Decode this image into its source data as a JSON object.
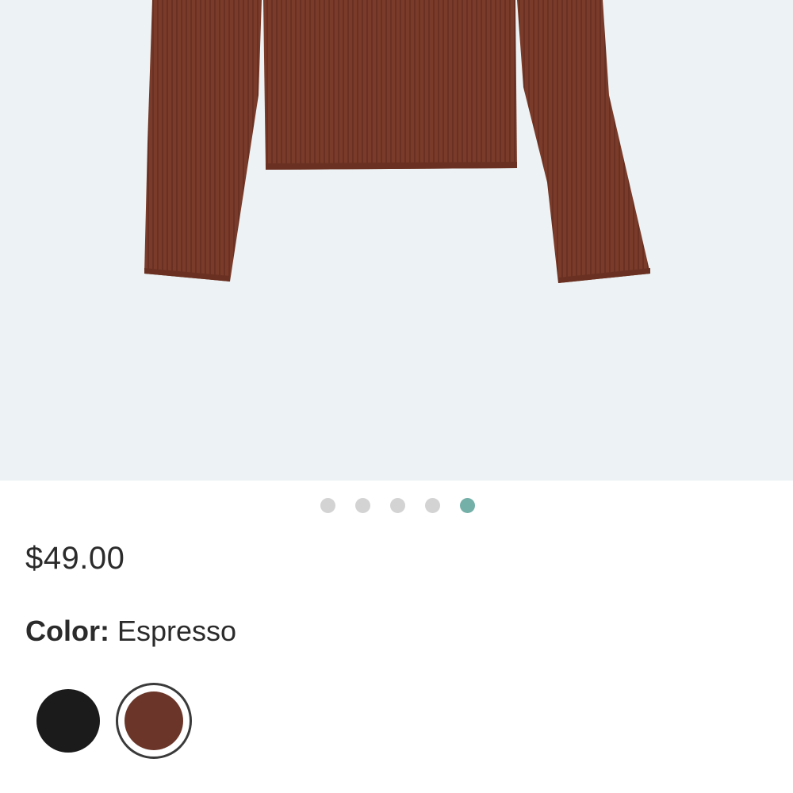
{
  "product": {
    "image_alt": "Espresso ribbed long sleeve top",
    "image_count": 5,
    "active_image_index": 4,
    "price": "$49.00",
    "color_label": "Color:",
    "color_value": "Espresso",
    "swatches": [
      {
        "name": "Black",
        "hex": "#1b1b1b",
        "selected": false
      },
      {
        "name": "Espresso",
        "hex": "#6b3629",
        "selected": true
      }
    ]
  },
  "colors": {
    "image_background": "#edf2f4",
    "dot_inactive": "#d3d3d3",
    "dot_active": "#74b0a8",
    "garment": "#7a3b2a",
    "garment_shadow": "#5f2c1f",
    "text": "#2b2b2b"
  }
}
